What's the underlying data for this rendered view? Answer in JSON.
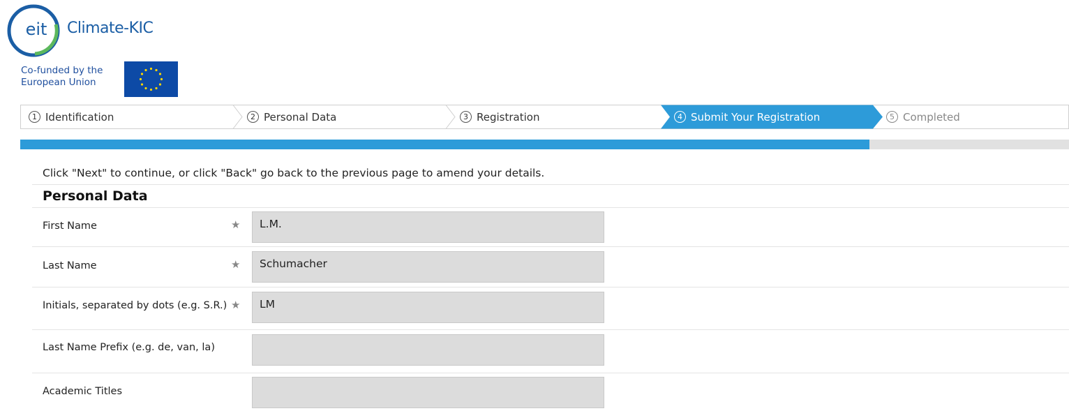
{
  "header": {
    "logo_abbrev": "eit",
    "logo_name": "Climate-KIC",
    "cofund_line1": "Co-funded by the",
    "cofund_line2": "European Union"
  },
  "stepper": {
    "steps": [
      {
        "num": "1",
        "label": "Identification",
        "state": "done"
      },
      {
        "num": "2",
        "label": "Personal Data",
        "state": "done"
      },
      {
        "num": "3",
        "label": "Registration",
        "state": "done"
      },
      {
        "num": "4",
        "label": "Submit Your Registration",
        "state": "active"
      },
      {
        "num": "5",
        "label": "Completed",
        "state": "disabled"
      }
    ],
    "active_color": "#2d9bd9"
  },
  "progress": {
    "fraction": 0.81
  },
  "instruction": "Click \"Next\" to continue, or click \"Back\" go back to the previous page to amend your details.",
  "section": {
    "title": "Personal Data"
  },
  "fields": [
    {
      "label": "First Name",
      "required": true,
      "value": "L.M."
    },
    {
      "label": "Last Name",
      "required": true,
      "value": "Schumacher"
    },
    {
      "label": "Initials, separated by dots (e.g. S.R.)",
      "required": true,
      "value": "LM"
    },
    {
      "label": "Last Name Prefix (e.g. de, van, la)",
      "required": false,
      "value": ""
    },
    {
      "label": "Academic Titles",
      "required": false,
      "value": ""
    }
  ],
  "required_marker": "★",
  "colors": {
    "brand_blue": "#1b5ea5",
    "eit_green": "#4caf50",
    "field_bg": "#dcdcdc"
  }
}
